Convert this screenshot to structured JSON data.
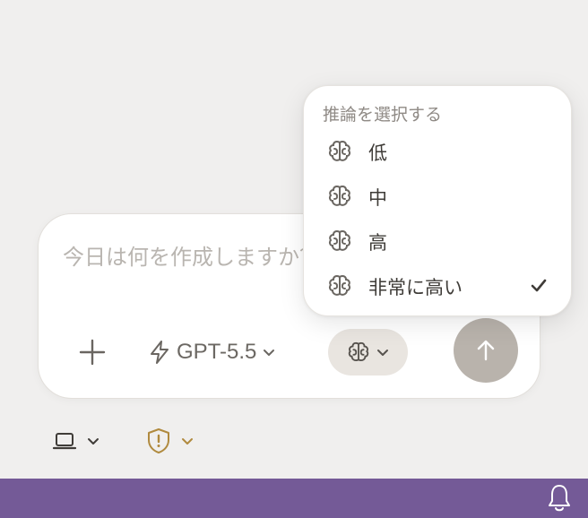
{
  "composer": {
    "placeholder": "今日は何を作成しますか？",
    "model_label": "GPT-5.5"
  },
  "reasoning_menu": {
    "heading": "推論を選択する",
    "items": [
      {
        "label": "低",
        "selected": false
      },
      {
        "label": "中",
        "selected": false
      },
      {
        "label": "高",
        "selected": false
      },
      {
        "label": "非常に高い",
        "selected": true
      }
    ]
  },
  "icons": {
    "add": "plus-icon",
    "model": "lightning-icon",
    "reasoning": "brain-icon",
    "send": "arrow-up-icon",
    "computer": "laptop-icon",
    "permissions": "shield-alert-icon",
    "notifications": "bell-icon",
    "selected": "checkmark-icon"
  },
  "colors": {
    "statusbar": "#745a97",
    "send_button": "#b9b3ac",
    "shield_accent": "#b08a3e"
  }
}
